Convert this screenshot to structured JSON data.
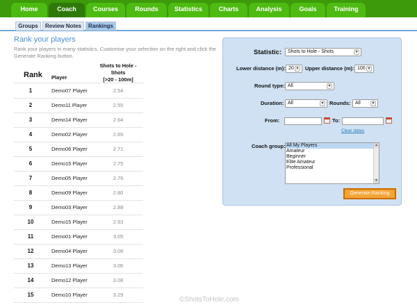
{
  "nav": {
    "tabs": [
      {
        "label": "Home"
      },
      {
        "label": "Coach"
      },
      {
        "label": "Courses"
      },
      {
        "label": "Rounds"
      },
      {
        "label": "Statistics"
      },
      {
        "label": "Charts"
      },
      {
        "label": "Analysis"
      },
      {
        "label": "Goals"
      },
      {
        "label": "Training"
      }
    ],
    "active": "Coach"
  },
  "subnav": {
    "tabs": [
      {
        "label": "Groups"
      },
      {
        "label": "Review Notes"
      },
      {
        "label": "Rankings"
      }
    ],
    "active": "Rankings"
  },
  "page": {
    "title": "Rank your players",
    "description": "Rank your players in many statistics. Customise your selection on the right and click the Generate Ranking button."
  },
  "table": {
    "rank_header": "Rank",
    "player_header": "Player",
    "metric_header_line1": "Shots to Hole -",
    "metric_header_line2": "Shots",
    "metric_header_line3": "[>20 - 100m]",
    "rows": [
      {
        "rank": "1",
        "player": "Demo07 Player",
        "value": "2.54"
      },
      {
        "rank": "2",
        "player": "Demo11 Player",
        "value": "2.55"
      },
      {
        "rank": "3",
        "player": "Demo14 Player",
        "value": "2.64"
      },
      {
        "rank": "4",
        "player": "Demo02 Player",
        "value": "2.65"
      },
      {
        "rank": "5",
        "player": "Demo06 Player",
        "value": "2.71"
      },
      {
        "rank": "6",
        "player": "Demo15 Player",
        "value": "2.75"
      },
      {
        "rank": "7",
        "player": "Demo05 Player",
        "value": "2.76"
      },
      {
        "rank": "8",
        "player": "Demo09 Player",
        "value": "2.80"
      },
      {
        "rank": "9",
        "player": "Demo03 Player",
        "value": "2.88"
      },
      {
        "rank": "10",
        "player": "Demo15 Player",
        "value": "2.93"
      },
      {
        "rank": "11",
        "player": "Demo01 Player",
        "value": "3.05"
      },
      {
        "rank": "12",
        "player": "Demo04 Player",
        "value": "3.06"
      },
      {
        "rank": "13",
        "player": "Demo13 Player",
        "value": "3.06"
      },
      {
        "rank": "14",
        "player": "Demo12 Player",
        "value": "3.08"
      },
      {
        "rank": "15",
        "player": "Demo10 Player",
        "value": "3.29"
      }
    ]
  },
  "form": {
    "statistic_label": "Statistic:",
    "statistic_value": "Shots to Hole - Shots",
    "lower_label": "Lower distance (m):",
    "lower_value": "20",
    "upper_label": "Upper distance (m):",
    "upper_value": "100",
    "round_type_label": "Round type:",
    "round_type_value": "All",
    "duration_label": "Duration:",
    "duration_value": "All",
    "rounds_label": "Rounds:",
    "rounds_value": "All",
    "from_label": "From:",
    "to_label": "To:",
    "clear_dates": "Clear dates",
    "coach_group_label": "Coach group:",
    "coach_groups": [
      "All My Players",
      "Amateur",
      "Beginner",
      "Elite Amateur",
      "Professional"
    ],
    "coach_group_selected": "All My Players",
    "generate_button": "Generate Ranking"
  },
  "footer": {
    "text": "©ShotsToHole.com"
  },
  "colors": {
    "nav_bar": "#3d9a0b",
    "nav_tab": "#4dbb11",
    "nav_tab_active": "#2d7a08",
    "panel_bg": "#cfe1f3",
    "accent_blue": "#4a90d2",
    "button_orange": "#f4a437"
  }
}
